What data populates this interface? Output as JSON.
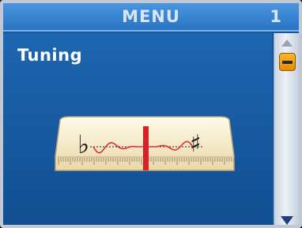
{
  "header": {
    "title": "MENU",
    "page_number": "1"
  },
  "section": {
    "title": "Tuning"
  },
  "tuner": {
    "flat_symbol": "♭",
    "sharp_symbol": "♯"
  },
  "icons": {
    "scroll_up": "triangle-up",
    "scroll_down": "triangle-down",
    "scroll_thumb": "minus"
  }
}
